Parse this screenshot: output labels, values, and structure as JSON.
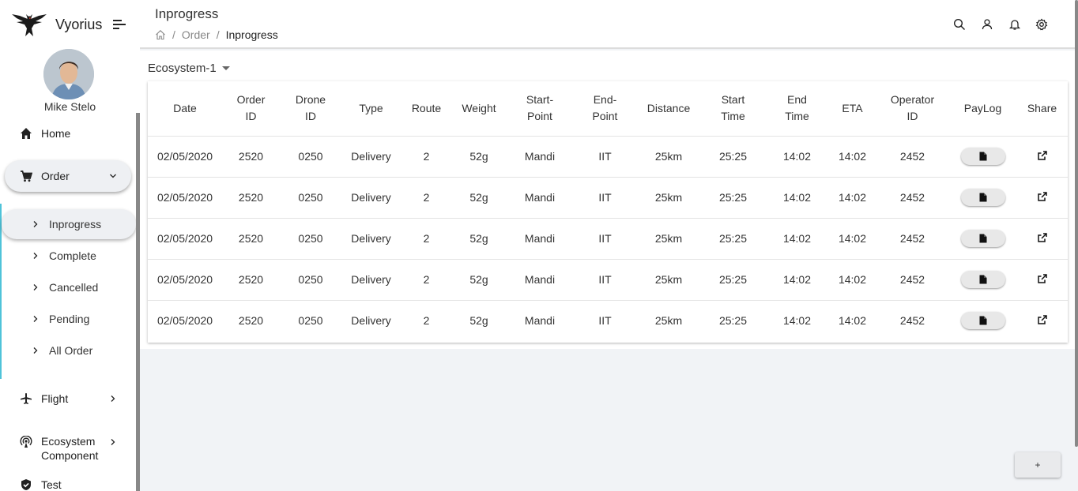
{
  "brand": {
    "name": "Vyorius"
  },
  "user": {
    "name": "Mike Stelo"
  },
  "nav": {
    "home": "Home",
    "order": "Order",
    "order_sub": [
      "Inprogress",
      "Complete",
      "Cancelled",
      "Pending",
      "All Order"
    ],
    "flight": "Flight",
    "ecosystem_line1": "Ecosystem",
    "ecosystem_line2": "Component",
    "test": "Test"
  },
  "header": {
    "title": "Inprogress",
    "breadcrumb": [
      "Order",
      "Inprogress"
    ],
    "icons": [
      "search-icon",
      "user-icon",
      "bell-icon",
      "gear-icon"
    ]
  },
  "ecosystem_select": "Ecosystem-1",
  "table": {
    "headers": [
      [
        "Date"
      ],
      [
        "Order",
        "ID"
      ],
      [
        "Drone",
        "ID"
      ],
      [
        "Type"
      ],
      [
        "Route"
      ],
      [
        "Weight"
      ],
      [
        "Start-",
        "Point"
      ],
      [
        "End-",
        "Point"
      ],
      [
        "Distance"
      ],
      [
        "Start",
        "Time"
      ],
      [
        "End",
        "Time"
      ],
      [
        "ETA"
      ],
      [
        "Operator",
        "ID"
      ],
      [
        "PayLog"
      ],
      [
        "Share"
      ]
    ],
    "rows": [
      [
        "02/05/2020",
        "2520",
        "0250",
        "Delivery",
        "2",
        "52g",
        "Mandi",
        "IIT",
        "25km",
        "25:25",
        "14:02",
        "14:02",
        "2452"
      ],
      [
        "02/05/2020",
        "2520",
        "0250",
        "Delivery",
        "2",
        "52g",
        "Mandi",
        "IIT",
        "25km",
        "25:25",
        "14:02",
        "14:02",
        "2452"
      ],
      [
        "02/05/2020",
        "2520",
        "0250",
        "Delivery",
        "2",
        "52g",
        "Mandi",
        "IIT",
        "25km",
        "25:25",
        "14:02",
        "14:02",
        "2452"
      ],
      [
        "02/05/2020",
        "2520",
        "0250",
        "Delivery",
        "2",
        "52g",
        "Mandi",
        "IIT",
        "25km",
        "25:25",
        "14:02",
        "14:02",
        "2452"
      ],
      [
        "02/05/2020",
        "2520",
        "0250",
        "Delivery",
        "2",
        "52g",
        "Mandi",
        "IIT",
        "25km",
        "25:25",
        "14:02",
        "14:02",
        "2452"
      ]
    ]
  },
  "fab": {
    "label": "+"
  },
  "colors": {
    "accent": "#4fc3d9",
    "background": "#f1f3f6"
  }
}
